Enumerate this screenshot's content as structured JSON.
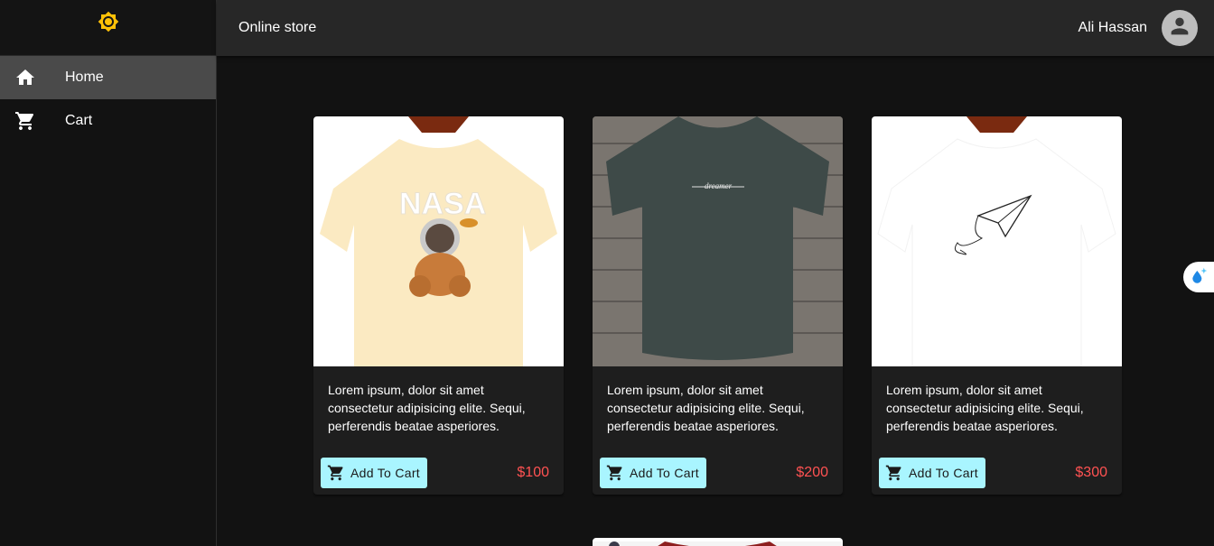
{
  "sidebar": {
    "logo_icon": "sun-icon",
    "items": [
      {
        "label": "Home",
        "icon": "home-icon",
        "active": true
      },
      {
        "label": "Cart",
        "icon": "cart-icon",
        "active": false
      }
    ]
  },
  "header": {
    "title": "Online store",
    "user_name": "Ali Hassan",
    "avatar_icon": "account-icon"
  },
  "products": [
    {
      "description": "Lorem ipsum, dolor sit amet consectetur adipisicing elite. Sequi, perferendis beatae asperiores.",
      "button_label": "Add To Cart",
      "price": "$100"
    },
    {
      "description": "Lorem ipsum, dolor sit amet consectetur adipisicing elite. Sequi, perferendis beatae asperiores.",
      "button_label": "Add To Cart",
      "price": "$200"
    },
    {
      "description": "Lorem ipsum, dolor sit amet consectetur adipisicing elite. Sequi, perferendis beatae asperiores.",
      "button_label": "Add To Cart",
      "price": "$300"
    }
  ],
  "colors": {
    "accent_button": "#a9f5ff",
    "price": "#ff5252",
    "logo": "#ffc107"
  }
}
